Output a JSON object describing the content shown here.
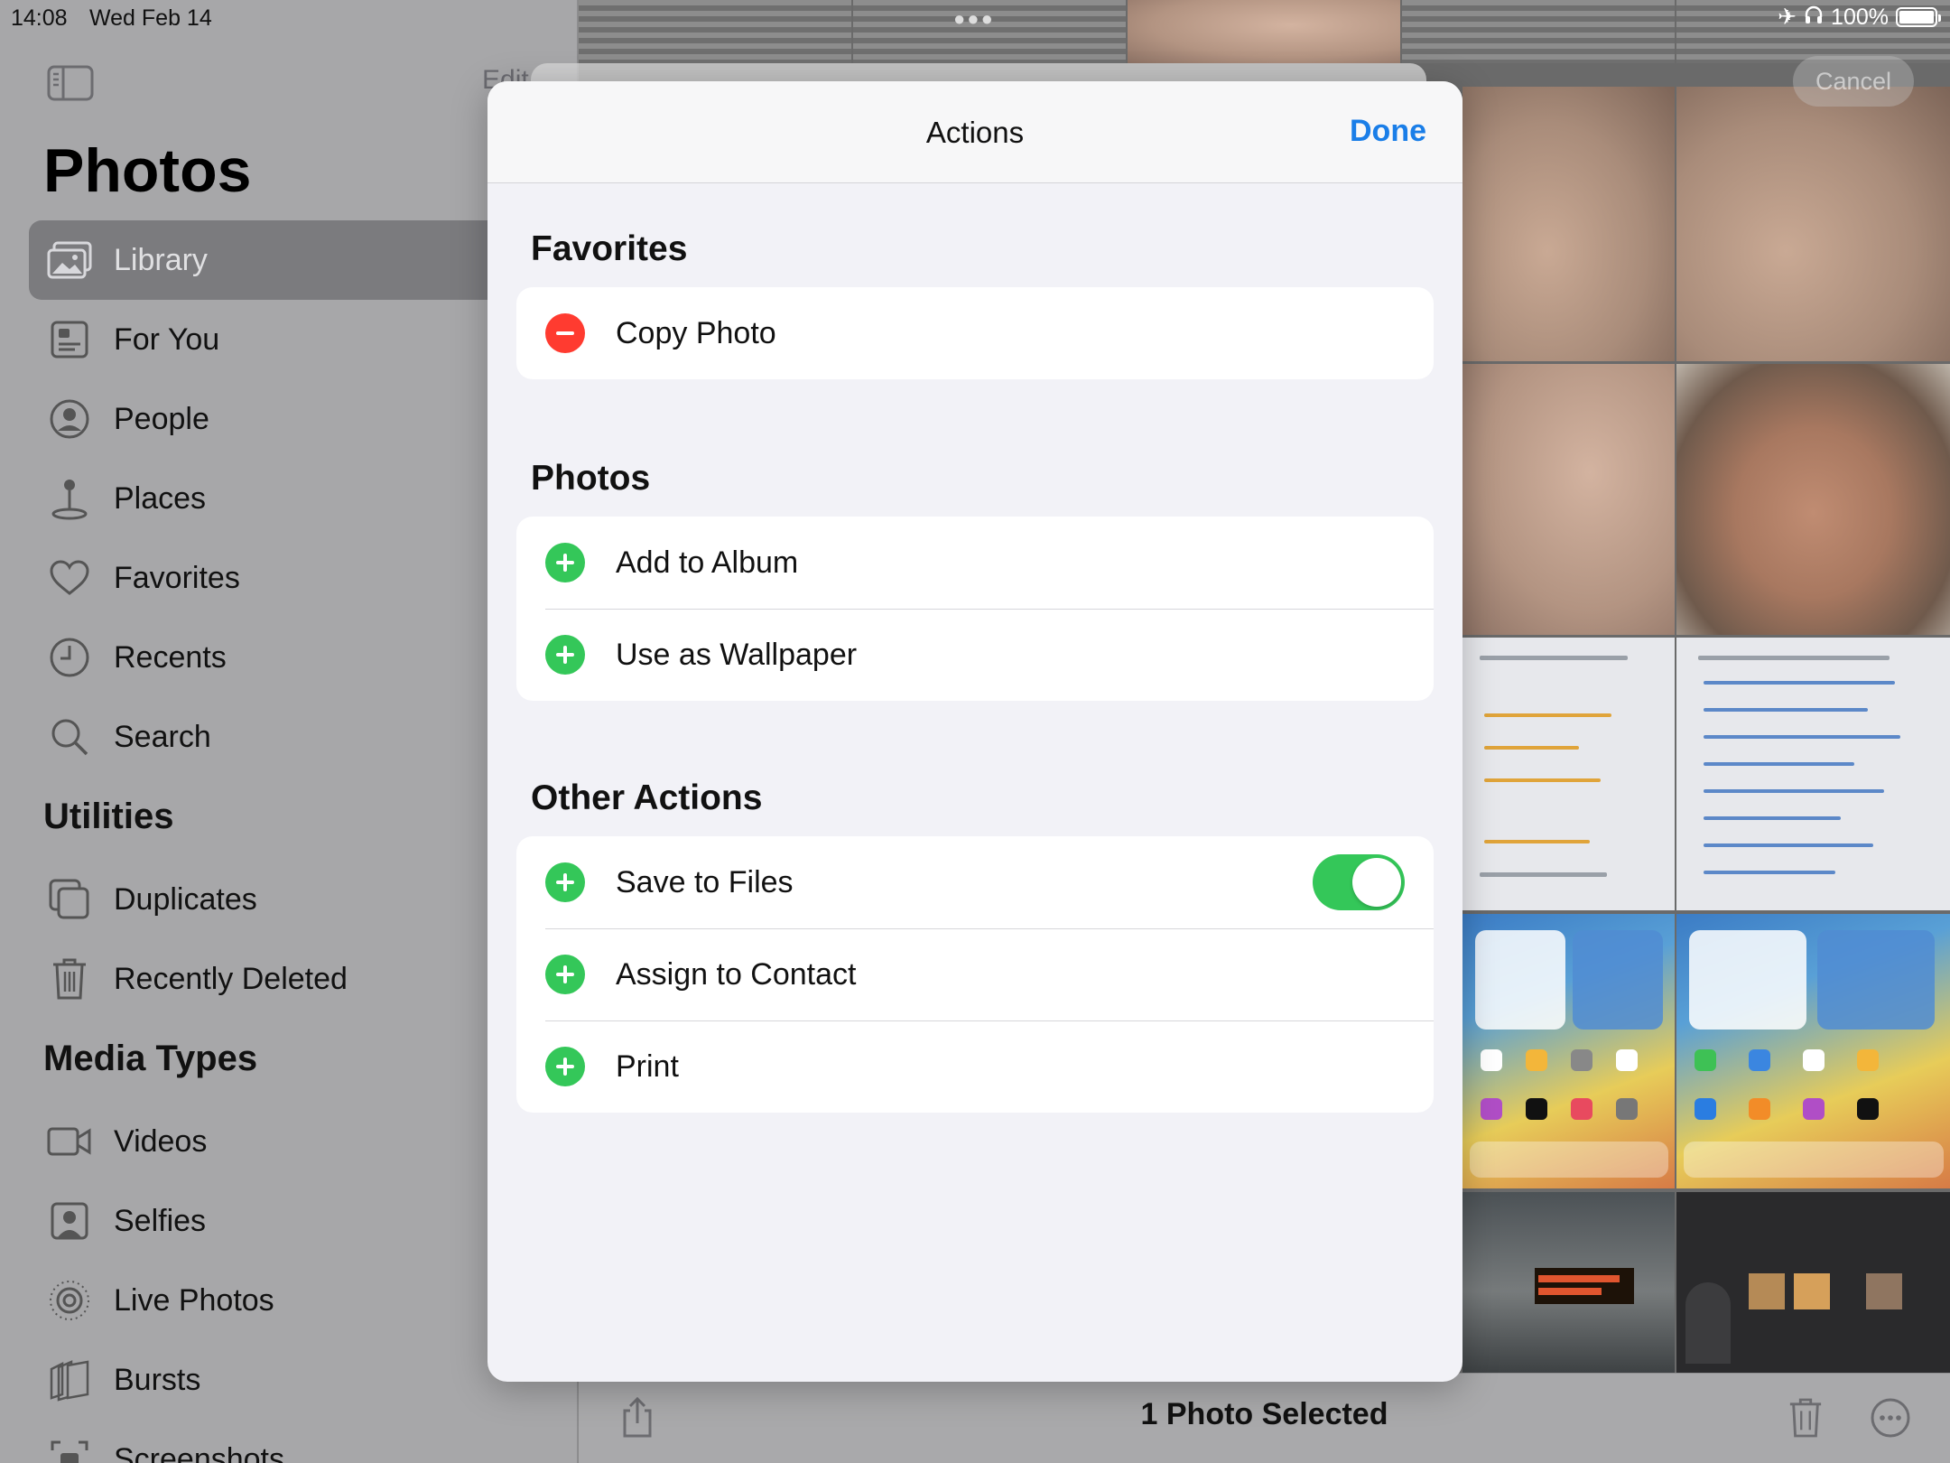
{
  "status_bar": {
    "time": "14:08",
    "date": "Wed Feb 14",
    "battery": "100%"
  },
  "sidebar": {
    "edit_label": "Edit",
    "title": "Photos",
    "items": [
      {
        "label": "Library",
        "icon": "photo-library-icon",
        "selected": true
      },
      {
        "label": "For You",
        "icon": "for-you-icon"
      },
      {
        "label": "People",
        "icon": "person-circle-icon"
      },
      {
        "label": "Places",
        "icon": "map-pin-icon"
      },
      {
        "label": "Favorites",
        "icon": "heart-icon"
      },
      {
        "label": "Recents",
        "icon": "clock-icon"
      },
      {
        "label": "Search",
        "icon": "search-icon"
      }
    ],
    "utilities_title": "Utilities",
    "utilities": [
      {
        "label": "Duplicates",
        "icon": "duplicates-icon"
      },
      {
        "label": "Recently Deleted",
        "icon": "trash-icon"
      }
    ],
    "media_types_title": "Media Types",
    "media_types": [
      {
        "label": "Videos",
        "icon": "video-icon"
      },
      {
        "label": "Selfies",
        "icon": "selfie-icon"
      },
      {
        "label": "Live Photos",
        "icon": "live-photo-icon"
      },
      {
        "label": "Bursts",
        "icon": "bursts-icon"
      },
      {
        "label": "Screenshots",
        "icon": "screenshot-icon"
      }
    ]
  },
  "grid": {
    "cancel_label": "Cancel"
  },
  "toolbar": {
    "title": "1 Photo Selected"
  },
  "modal": {
    "title": "Actions",
    "done_label": "Done",
    "groups": [
      {
        "title": "Favorites",
        "rows": [
          {
            "label": "Copy Photo",
            "type": "remove"
          }
        ]
      },
      {
        "title": "Photos",
        "rows": [
          {
            "label": "Add to Album",
            "type": "add"
          },
          {
            "label": "Use as Wallpaper",
            "type": "add"
          }
        ]
      },
      {
        "title": "Other Actions",
        "rows": [
          {
            "label": "Save to Files",
            "type": "add",
            "toggle": true
          },
          {
            "label": "Assign to Contact",
            "type": "add"
          },
          {
            "label": "Print",
            "type": "add"
          }
        ]
      }
    ]
  },
  "colors": {
    "accent": "#1a7ee8",
    "add_green": "#34c759",
    "remove_red": "#ff3b30"
  }
}
